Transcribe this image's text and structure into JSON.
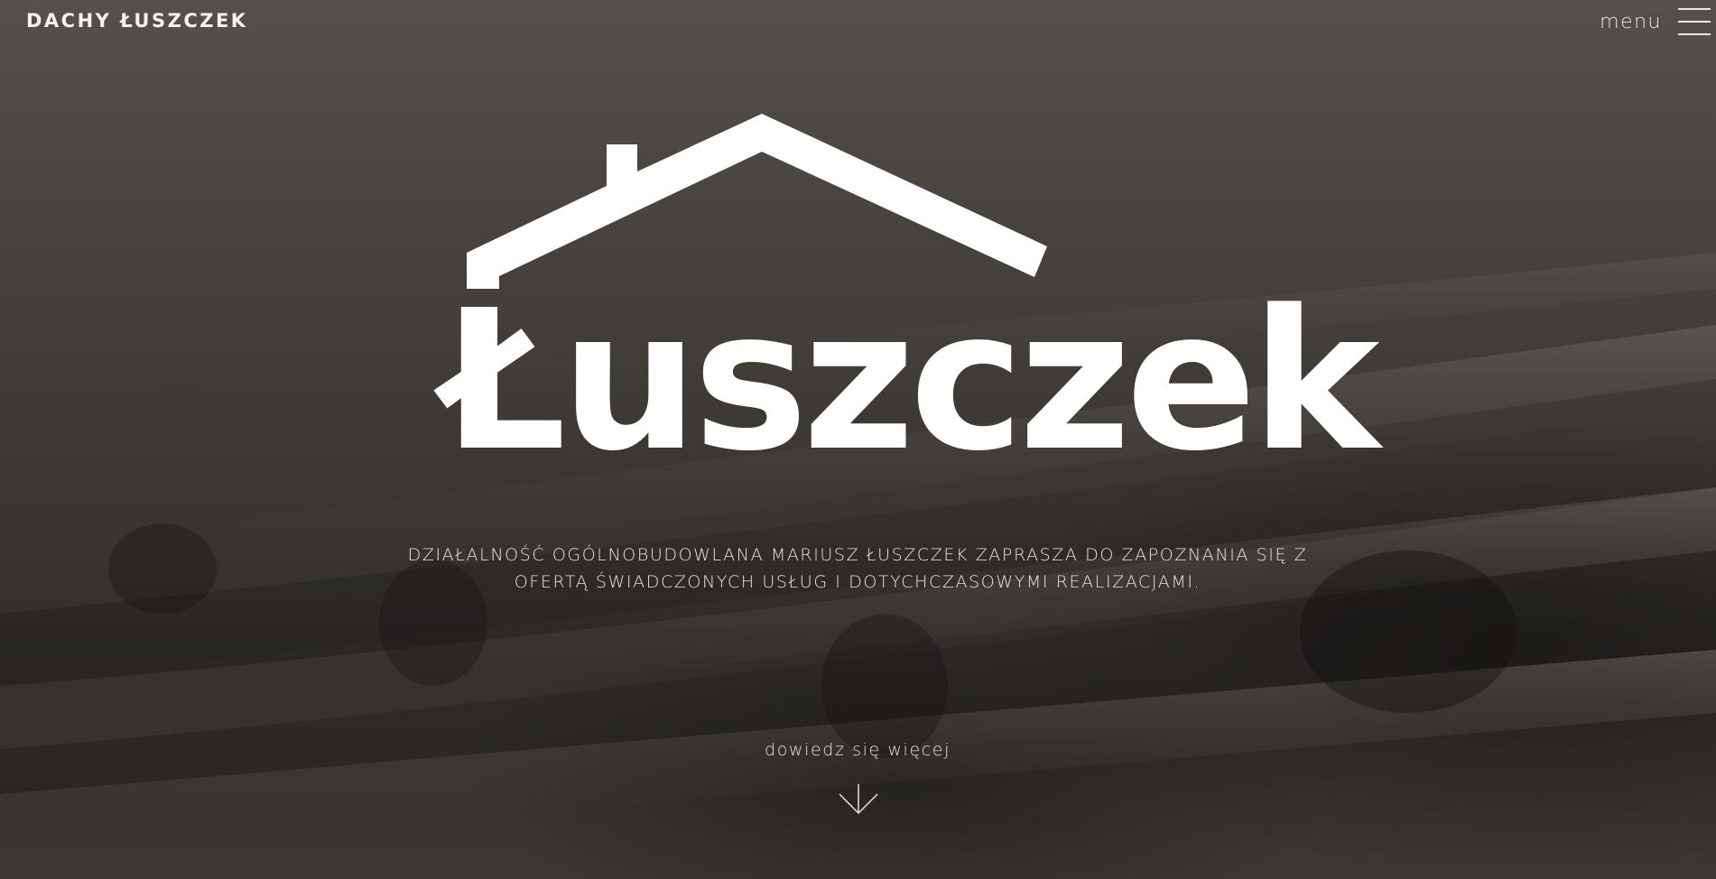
{
  "header": {
    "brand": "DACHY ŁUSZCZEK",
    "menu_label": "menu",
    "menu_icon": "hamburger-icon"
  },
  "hero": {
    "logo_word": "Łuszczek",
    "logo_icon": "house-roof-icon",
    "tagline_line1": "DZIAŁALNOŚĆ OGÓLNOBUDOWLANA MARIUSZ ŁUSZCZEK ZAPRASZA DO ZAPOZNANIA SIĘ Z",
    "tagline_line2": "OFERTĄ ŚWIADCZONYCH USŁUG I DOTYCHCZASOWYMI REALIZACJAMI.",
    "more_label": "dowiedz się więcej",
    "more_icon": "arrow-down-icon"
  },
  "colors": {
    "text": "#ffffff",
    "background": "#3c3935"
  }
}
